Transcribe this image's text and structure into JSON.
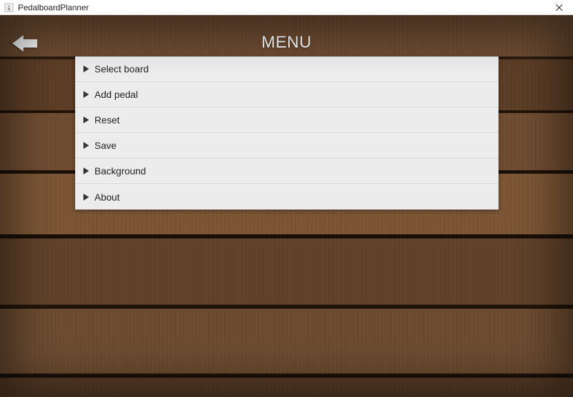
{
  "window": {
    "title": "PedalboardPlanner"
  },
  "heading": "MENU",
  "menu": {
    "items": [
      {
        "label": "Select board"
      },
      {
        "label": "Add pedal"
      },
      {
        "label": "Reset"
      },
      {
        "label": "Save"
      },
      {
        "label": "Background"
      },
      {
        "label": "About"
      }
    ]
  }
}
